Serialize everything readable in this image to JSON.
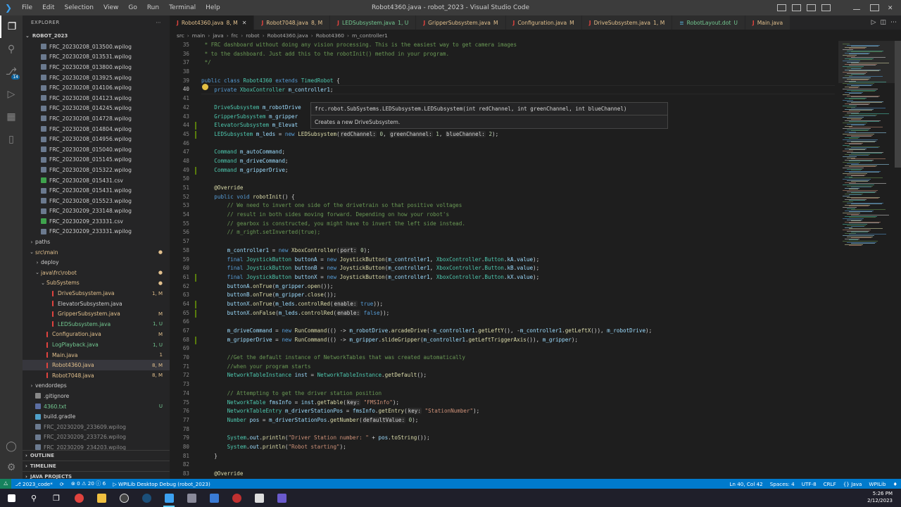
{
  "window": {
    "title": "Robot4360.java - robot_2023 - Visual Studio Code",
    "menu": [
      "File",
      "Edit",
      "Selection",
      "View",
      "Go",
      "Run",
      "Terminal",
      "Help"
    ]
  },
  "activity_bar": {
    "scm_badge": "14"
  },
  "explorer": {
    "header": "EXPLORER",
    "root": "ROBOT_2023",
    "items": [
      {
        "label": "FRC_20230208_013500.wpilog",
        "indent": 2,
        "type": "log",
        "color": "normal"
      },
      {
        "label": "FRC_20230208_013531.wpilog",
        "indent": 2,
        "type": "log",
        "color": "normal"
      },
      {
        "label": "FRC_20230208_013800.wpilog",
        "indent": 2,
        "type": "log",
        "color": "normal"
      },
      {
        "label": "FRC_20230208_013925.wpilog",
        "indent": 2,
        "type": "log",
        "color": "normal"
      },
      {
        "label": "FRC_20230208_014106.wpilog",
        "indent": 2,
        "type": "log",
        "color": "normal"
      },
      {
        "label": "FRC_20230208_014123.wpilog",
        "indent": 2,
        "type": "log",
        "color": "normal"
      },
      {
        "label": "FRC_20230208_014245.wpilog",
        "indent": 2,
        "type": "log",
        "color": "normal"
      },
      {
        "label": "FRC_20230208_014728.wpilog",
        "indent": 2,
        "type": "log",
        "color": "normal"
      },
      {
        "label": "FRC_20230208_014804.wpilog",
        "indent": 2,
        "type": "log",
        "color": "normal"
      },
      {
        "label": "FRC_20230208_014956.wpilog",
        "indent": 2,
        "type": "log",
        "color": "normal"
      },
      {
        "label": "FRC_20230208_015040.wpilog",
        "indent": 2,
        "type": "log",
        "color": "normal"
      },
      {
        "label": "FRC_20230208_015145.wpilog",
        "indent": 2,
        "type": "log",
        "color": "normal"
      },
      {
        "label": "FRC_20230208_015322.wpilog",
        "indent": 2,
        "type": "log",
        "color": "normal"
      },
      {
        "label": "FRC_20230208_015431.csv",
        "indent": 2,
        "type": "csv",
        "color": "normal"
      },
      {
        "label": "FRC_20230208_015431.wpilog",
        "indent": 2,
        "type": "log",
        "color": "normal"
      },
      {
        "label": "FRC_20230208_015523.wpilog",
        "indent": 2,
        "type": "log",
        "color": "normal"
      },
      {
        "label": "FRC_20230209_233148.wpilog",
        "indent": 2,
        "type": "log",
        "color": "normal"
      },
      {
        "label": "FRC_20230209_233331.csv",
        "indent": 2,
        "type": "csv",
        "color": "normal"
      },
      {
        "label": "FRC_20230209_233331.wpilog",
        "indent": 2,
        "type": "log",
        "color": "normal"
      },
      {
        "label": "paths",
        "indent": 1,
        "type": "folder-closed",
        "color": "normal"
      },
      {
        "label": "src\\main",
        "indent": 1,
        "type": "folder-open",
        "color": "mod",
        "status": "●"
      },
      {
        "label": "deploy",
        "indent": 2,
        "type": "folder-closed",
        "color": "normal"
      },
      {
        "label": "java\\frc\\robot",
        "indent": 2,
        "type": "folder-open",
        "color": "mod",
        "status": "●"
      },
      {
        "label": "SubSystems",
        "indent": 3,
        "type": "folder-open",
        "color": "mod",
        "status": "●"
      },
      {
        "label": "DriveSubsystem.java",
        "indent": 4,
        "type": "java",
        "color": "mod",
        "status": "1, M"
      },
      {
        "label": "ElevatorSubsystem.java",
        "indent": 4,
        "type": "java",
        "color": "normal"
      },
      {
        "label": "GripperSubsystem.java",
        "indent": 4,
        "type": "java",
        "color": "mod",
        "status": "M"
      },
      {
        "label": "LEDSubsystem.java",
        "indent": 4,
        "type": "java",
        "color": "unt",
        "status": "1, U"
      },
      {
        "label": "Configuration.java",
        "indent": 3,
        "type": "java",
        "color": "mod",
        "status": "M"
      },
      {
        "label": "LogPlayback.java",
        "indent": 3,
        "type": "java",
        "color": "unt",
        "status": "1, U"
      },
      {
        "label": "Main.java",
        "indent": 3,
        "type": "java",
        "color": "mod",
        "status": "1"
      },
      {
        "label": "Robot4360.java",
        "indent": 3,
        "type": "java",
        "color": "mod",
        "status": "8, M",
        "selected": true
      },
      {
        "label": "Robot7048.java",
        "indent": 3,
        "type": "java",
        "color": "mod",
        "status": "8, M"
      },
      {
        "label": "vendordeps",
        "indent": 1,
        "type": "folder-closed",
        "color": "normal"
      },
      {
        "label": ".gitignore",
        "indent": 1,
        "type": "git",
        "color": "normal"
      },
      {
        "label": "4360.txt",
        "indent": 1,
        "type": "txt",
        "color": "unt",
        "status": "U"
      },
      {
        "label": "build.gradle",
        "indent": 1,
        "type": "gradle",
        "color": "normal"
      },
      {
        "label": "FRC_20230209_233609.wpilog",
        "indent": 1,
        "type": "log",
        "color": "git"
      },
      {
        "label": "FRC_20230209_233726.wpilog",
        "indent": 1,
        "type": "log",
        "color": "git"
      },
      {
        "label": "FRC_20230209_234203.wpilog",
        "indent": 1,
        "type": "log",
        "color": "git"
      }
    ],
    "sections": [
      "OUTLINE",
      "TIMELINE",
      "JAVA PROJECTS"
    ]
  },
  "tabs": [
    {
      "label": "Robot4360.java",
      "status": "8, M",
      "active": true,
      "color": "mod"
    },
    {
      "label": "Robot7048.java",
      "status": "8, M",
      "color": "mod"
    },
    {
      "label": "LEDSubsystem.java",
      "status": "1, U",
      "color": "unt"
    },
    {
      "label": "GripperSubsystem.java",
      "status": "M",
      "color": "mod"
    },
    {
      "label": "Configuration.java",
      "status": "M",
      "color": "mod"
    },
    {
      "label": "DriveSubsystem.java",
      "status": "1, M",
      "color": "mod"
    },
    {
      "label": "RobotLayout.dot",
      "status": "U",
      "color": "unt"
    },
    {
      "label": "Main.java",
      "status": "",
      "color": "mod"
    }
  ],
  "breadcrumb": [
    "src",
    "main",
    "java",
    "frc",
    "robot",
    "Robot4360.java",
    "Robot4360",
    "m_controller1"
  ],
  "editor": {
    "current_line": 40,
    "lines": [
      {
        "n": 35,
        "gm": "",
        "html": "<span class=\"c\"> * FRC dashboard without doing any vision processing. This is the easiest way to get camera images</span>"
      },
      {
        "n": 36,
        "gm": "",
        "html": "<span class=\"c\"> * to the dashboard. Just add this to the robotInit() method in your program.</span>"
      },
      {
        "n": 37,
        "gm": "",
        "html": "<span class=\"c\"> */</span>"
      },
      {
        "n": 38,
        "gm": "",
        "html": ""
      },
      {
        "n": 39,
        "gm": "",
        "html": "<span class=\"k\">public class</span> <span class=\"t\">Robot4360</span> <span class=\"k\">extends</span> <span class=\"t\">TimedRobot</span> {"
      },
      {
        "n": 40,
        "gm": "",
        "html": "    <span class=\"k\">private</span> <span class=\"t\">XboxController</span> <span class=\"v\">m_controller1</span>;"
      },
      {
        "n": 41,
        "gm": "",
        "html": ""
      },
      {
        "n": 42,
        "gm": "",
        "html": "    <span class=\"t\">DriveSubsystem</span> <span class=\"v\">m_robotDrive</span>"
      },
      {
        "n": 43,
        "gm": "",
        "html": "    <span class=\"t\">GripperSubsystem</span> <span class=\"v\">m_gripper</span>"
      },
      {
        "n": 44,
        "gm": "g",
        "html": "    <span class=\"t\">ElevatorSubsystem</span> <span class=\"v\">m_Elevat</span>"
      },
      {
        "n": 45,
        "gm": "g",
        "html": "    <span class=\"t\">LEDSubsystem</span> <span class=\"v\">m_leds</span> = <span class=\"k\">new</span> <span class=\"f\">LEDSubsystem</span>(<span class=\"hint\">redChannel:</span> <span class=\"n\">0</span>, <span class=\"hint\">greenChannel:</span> <span class=\"n\">1</span>, <span class=\"hint\">blueChannel:</span> <span class=\"n\">2</span>);"
      },
      {
        "n": 46,
        "gm": "",
        "html": ""
      },
      {
        "n": 47,
        "gm": "",
        "html": "    <span class=\"t\">Command</span> <span class=\"v\">m_autoCommand</span>;"
      },
      {
        "n": 48,
        "gm": "",
        "html": "    <span class=\"t\">Command</span> <span class=\"v\">m_driveCommand</span>;"
      },
      {
        "n": 49,
        "gm": "g",
        "html": "    <span class=\"t\">Command</span> <span class=\"v\">m_gripperDrive</span>;"
      },
      {
        "n": 50,
        "gm": "",
        "html": ""
      },
      {
        "n": 51,
        "gm": "",
        "html": "    <span class=\"a\">@Override</span>"
      },
      {
        "n": 52,
        "gm": "",
        "html": "    <span class=\"k\">public void</span> <span class=\"f\">robotInit</span>() {"
      },
      {
        "n": 53,
        "gm": "",
        "html": "        <span class=\"c\">// We need to invert one side of the drivetrain so that positive voltages</span>"
      },
      {
        "n": 54,
        "gm": "",
        "html": "        <span class=\"c\">// result in both sides moving forward. Depending on how your robot's</span>"
      },
      {
        "n": 55,
        "gm": "",
        "html": "        <span class=\"c\">// gearbox is constructed, you might have to invert the left side instead.</span>"
      },
      {
        "n": 56,
        "gm": "",
        "html": "        <span class=\"c\">// m_right.setInverted(true);</span>"
      },
      {
        "n": 57,
        "gm": "",
        "html": ""
      },
      {
        "n": 58,
        "gm": "",
        "html": "        <span class=\"v\">m_controller1</span> = <span class=\"k\">new</span> <span class=\"f\">XboxController</span>(<span class=\"hint\">port:</span> <span class=\"n\">0</span>);"
      },
      {
        "n": 59,
        "gm": "",
        "html": "        <span class=\"k\">final</span> <span class=\"t\">JoystickButton</span> <span class=\"v\">buttonA</span> = <span class=\"k\">new</span> <span class=\"f\">JoystickButton</span>(<span class=\"v\">m_controller1</span>, <span class=\"t\">XboxController</span>.<span class=\"t\">Button</span>.<span class=\"v\">kA</span>.<span class=\"v\">value</span>);"
      },
      {
        "n": 60,
        "gm": "",
        "html": "        <span class=\"k\">final</span> <span class=\"t\">JoystickButton</span> <span class=\"v\">buttonB</span> = <span class=\"k\">new</span> <span class=\"f\">JoystickButton</span>(<span class=\"v\">m_controller1</span>, <span class=\"t\">XboxController</span>.<span class=\"t\">Button</span>.<span class=\"v\">kB</span>.<span class=\"v\">value</span>);"
      },
      {
        "n": 61,
        "gm": "g",
        "html": "        <span class=\"k\">final</span> <span class=\"t\">JoystickButton</span> <span class=\"v\">buttonX</span> = <span class=\"k\">new</span> <span class=\"f\">JoystickButton</span>(<span class=\"v\">m_controller1</span>, <span class=\"t\">XboxController</span>.<span class=\"t\">Button</span>.<span class=\"v\">kX</span>.<span class=\"v\">value</span>);"
      },
      {
        "n": 62,
        "gm": "",
        "html": "        <span class=\"v\">buttonA</span>.<span class=\"f\">onTrue</span>(<span class=\"v\">m_gripper</span>.<span class=\"f\">open</span>());"
      },
      {
        "n": 63,
        "gm": "",
        "html": "        <span class=\"v\">buttonB</span>.<span class=\"f\">onTrue</span>(<span class=\"v\">m_gripper</span>.<span class=\"f\">close</span>());"
      },
      {
        "n": 64,
        "gm": "g",
        "html": "        <span class=\"v\">buttonX</span>.<span class=\"f\">onTrue</span>(<span class=\"v\">m_leds</span>.<span class=\"f\">controlRed</span>(<span class=\"hint\">enable:</span> <span class=\"kc\">true</span>));"
      },
      {
        "n": 65,
        "gm": "g",
        "html": "        <span class=\"v\">buttonX</span>.<span class=\"f\">onFalse</span>(<span class=\"v\">m_leds</span>.<span class=\"f\">controlRed</span>(<span class=\"hint\">enable:</span> <span class=\"kc\">false</span>));"
      },
      {
        "n": 66,
        "gm": "",
        "html": ""
      },
      {
        "n": 67,
        "gm": "",
        "html": "        <span class=\"v\">m_driveCommand</span> = <span class=\"k\">new</span> <span class=\"f\">RunCommand</span>(() -&gt; <span class=\"v\">m_robotDrive</span>.<span class=\"f\">arcadeDrive</span>(-<span class=\"v\">m_controller1</span>.<span class=\"f\">getLeftY</span>(), -<span class=\"v\">m_controller1</span>.<span class=\"f\">getLeftX</span>()), <span class=\"v\">m_robotDrive</span>);"
      },
      {
        "n": 68,
        "gm": "g",
        "html": "        <span class=\"v\">m_gripperDrive</span> = <span class=\"k\">new</span> <span class=\"f\">RunCommand</span>(() -&gt; <span class=\"v\">m_gripper</span>.<span class=\"f\">slideGripper</span>(<span class=\"v\">m_controller1</span>.<span class=\"f\">getLeftTriggerAxis</span>()), <span class=\"v\">m_gripper</span>);"
      },
      {
        "n": 69,
        "gm": "",
        "html": ""
      },
      {
        "n": 70,
        "gm": "",
        "html": "        <span class=\"c\">//Get the default instance of NetworkTables that was created automatically</span>"
      },
      {
        "n": 71,
        "gm": "",
        "html": "        <span class=\"c\">//when your program starts</span>"
      },
      {
        "n": 72,
        "gm": "",
        "html": "        <span class=\"t\">NetworkTableInstance</span> <span class=\"v\">inst</span> = <span class=\"t\">NetworkTableInstance</span>.<span class=\"f\">getDefault</span>();"
      },
      {
        "n": 73,
        "gm": "",
        "html": ""
      },
      {
        "n": 74,
        "gm": "",
        "html": "        <span class=\"c\">// Attempting to get the driver station position</span>"
      },
      {
        "n": 75,
        "gm": "",
        "html": "        <span class=\"t\">NetworkTable</span> <span class=\"v\">fmsInfo</span> = <span class=\"v\">inst</span>.<span class=\"f\">getTable</span>(<span class=\"hint\">key:</span> <span class=\"s\">\"FMSInfo\"</span>);"
      },
      {
        "n": 76,
        "gm": "",
        "html": "        <span class=\"t\">NetworkTableEntry</span> <span class=\"v\">m_driverStationPos</span> = <span class=\"v\">fmsInfo</span>.<span class=\"f\">getEntry</span>(<span class=\"hint\">key:</span> <span class=\"s\">\"StationNumber\"</span>);"
      },
      {
        "n": 77,
        "gm": "",
        "html": "        <span class=\"t\">Number</span> <span class=\"v\">pos</span> = <span class=\"v\">m_driverStationPos</span>.<span class=\"f\">getNumber</span>(<span class=\"hint\">defaultValue:</span> <span class=\"n\">0</span>);"
      },
      {
        "n": 78,
        "gm": "",
        "html": ""
      },
      {
        "n": 79,
        "gm": "",
        "html": "        <span class=\"t\">System</span>.<span class=\"v\">out</span>.<span class=\"f\">println</span>(<span class=\"s\">\"Driver Station number: \"</span> + <span class=\"v\">pos</span>.<span class=\"f\">toString</span>());"
      },
      {
        "n": 80,
        "gm": "",
        "html": "        <span class=\"t\">System</span>.<span class=\"v\">out</span>.<span class=\"f\">println</span>(<span class=\"s\">\"Robot starting\"</span>);"
      },
      {
        "n": 81,
        "gm": "",
        "html": "    }"
      },
      {
        "n": 82,
        "gm": "",
        "html": ""
      },
      {
        "n": 83,
        "gm": "",
        "html": "    <span class=\"a\">@Override</span>"
      }
    ]
  },
  "hover": {
    "signature": "frc.robot.SubSystems.LEDSubsystem.LEDSubsystem(int redChannel, int greenChannel, int blueChannel)",
    "doc": "Creates a new DriveSubsystem."
  },
  "status_bar": {
    "branch": "2023_code*",
    "problems": "⊗ 0 ⚠ 20 ⓘ 6",
    "debug": "WPILib Desktop Debug (robot_2023)",
    "position": "Ln 40, Col 42",
    "spaces": "Spaces: 4",
    "encoding": "UTF-8",
    "eol": "CRLF",
    "language": "{} Java",
    "wpilib": "WPILib"
  },
  "taskbar": {
    "time": "5:26 PM",
    "date": "2/12/2023"
  }
}
